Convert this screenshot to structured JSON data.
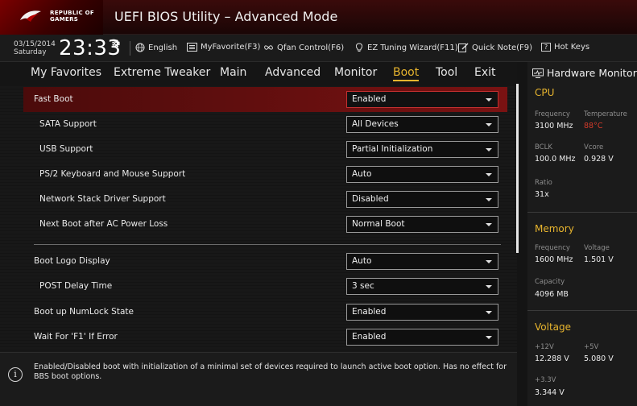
{
  "window": {
    "title": "UEFI BIOS Utility – Advanced Mode",
    "brand_line1": "REPUBLIC OF",
    "brand_line2": "GAMERS"
  },
  "toolbar": {
    "date": "03/15/2014",
    "day": "Saturday",
    "time": "23:33",
    "language": "English",
    "favorite": "MyFavorite(F3)",
    "qfan": "Qfan Control(F6)",
    "ez_tuning": "EZ Tuning Wizard(F11)",
    "quick_note": "Quick Note(F9)",
    "hot_keys": "Hot Keys",
    "hot_keys_glyph": "?"
  },
  "tabs": [
    {
      "label": "My Favorites"
    },
    {
      "label": "Extreme Tweaker"
    },
    {
      "label": "Main"
    },
    {
      "label": "Advanced"
    },
    {
      "label": "Monitor"
    },
    {
      "label": "Boot"
    },
    {
      "label": "Tool"
    },
    {
      "label": "Exit"
    }
  ],
  "active_tab": "Boot",
  "settings": [
    {
      "label": "Fast Boot",
      "value": "Enabled",
      "highlighted": true
    },
    {
      "label": "SATA Support",
      "value": "All Devices"
    },
    {
      "label": "USB Support",
      "value": "Partial Initialization"
    },
    {
      "label": "PS/2 Keyboard and Mouse Support",
      "value": "Auto"
    },
    {
      "label": "Network Stack Driver Support",
      "value": "Disabled"
    },
    {
      "label": "Next Boot after AC Power Loss",
      "value": "Normal Boot"
    },
    {
      "label": "Boot Logo Display",
      "value": "Auto"
    },
    {
      "label": "POST Delay Time",
      "value": "3 sec"
    },
    {
      "label": "Boot up NumLock State",
      "value": "Enabled"
    },
    {
      "label": "Wait For 'F1' If Error",
      "value": "Enabled"
    }
  ],
  "help": {
    "icon": "i",
    "text": "Enabled/Disabled boot with initialization of a minimal set of devices required to launch active boot option. Has no effect for BBS boot options."
  },
  "hardware_monitor": {
    "title": "Hardware Monitor",
    "cpu": {
      "heading": "CPU",
      "frequency_label": "Frequency",
      "frequency": "3100 MHz",
      "temperature_label": "Temperature",
      "temperature": "88°C",
      "bclk_label": "BCLK",
      "bclk": "100.0 MHz",
      "vcore_label": "Vcore",
      "vcore": "0.928 V",
      "ratio_label": "Ratio",
      "ratio": "31x"
    },
    "memory": {
      "heading": "Memory",
      "frequency_label": "Frequency",
      "frequency": "1600 MHz",
      "voltage_label": "Voltage",
      "voltage": "1.501 V",
      "capacity_label": "Capacity",
      "capacity": "4096 MB"
    },
    "voltage": {
      "heading": "Voltage",
      "v12_label": "+12V",
      "v12": "12.288 V",
      "v5_label": "+5V",
      "v5": "5.080 V",
      "v33_label": "+3.3V",
      "v33": "3.344 V"
    }
  },
  "colors": {
    "accent": "#e8b52e",
    "highlight_row": "#7a1212",
    "hot": "#d23a2a"
  }
}
